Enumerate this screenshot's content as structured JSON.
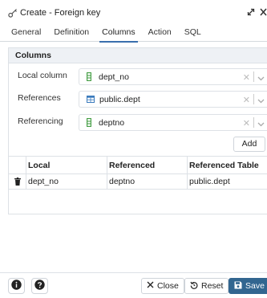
{
  "dialog": {
    "title": "Create - Foreign key",
    "title_icon": "foreign-key-icon",
    "controls": [
      "expand-icon",
      "close-icon"
    ]
  },
  "tabs": [
    {
      "label": "General",
      "active": false
    },
    {
      "label": "Definition",
      "active": false
    },
    {
      "label": "Columns",
      "active": true
    },
    {
      "label": "Action",
      "active": false
    },
    {
      "label": "SQL",
      "active": false
    }
  ],
  "columns_panel": {
    "header": "Columns",
    "local_column": {
      "label": "Local column",
      "value": "dept_no",
      "icon": "column-icon"
    },
    "references": {
      "label": "References",
      "value": "public.dept",
      "icon": "table-icon"
    },
    "referencing": {
      "label": "Referencing",
      "value": "deptno",
      "icon": "column-icon"
    },
    "add_label": "Add"
  },
  "grid": {
    "headers": [
      "Local",
      "Referenced",
      "Referenced Table"
    ],
    "rows": [
      {
        "local": "dept_no",
        "referenced": "deptno",
        "referenced_table": "public.dept"
      }
    ]
  },
  "footer": {
    "info_icon": "info-icon",
    "help_icon": "help-icon",
    "close_label": "Close",
    "reset_label": "Reset",
    "save_label": "Save"
  },
  "colors": {
    "accent": "#326690",
    "tab_underline": "#3a6fad",
    "border": "#dde1e6",
    "header_bg": "#eef1f5",
    "column_icon": "#3c9a3c",
    "table_icon": "#3b7bbd"
  }
}
